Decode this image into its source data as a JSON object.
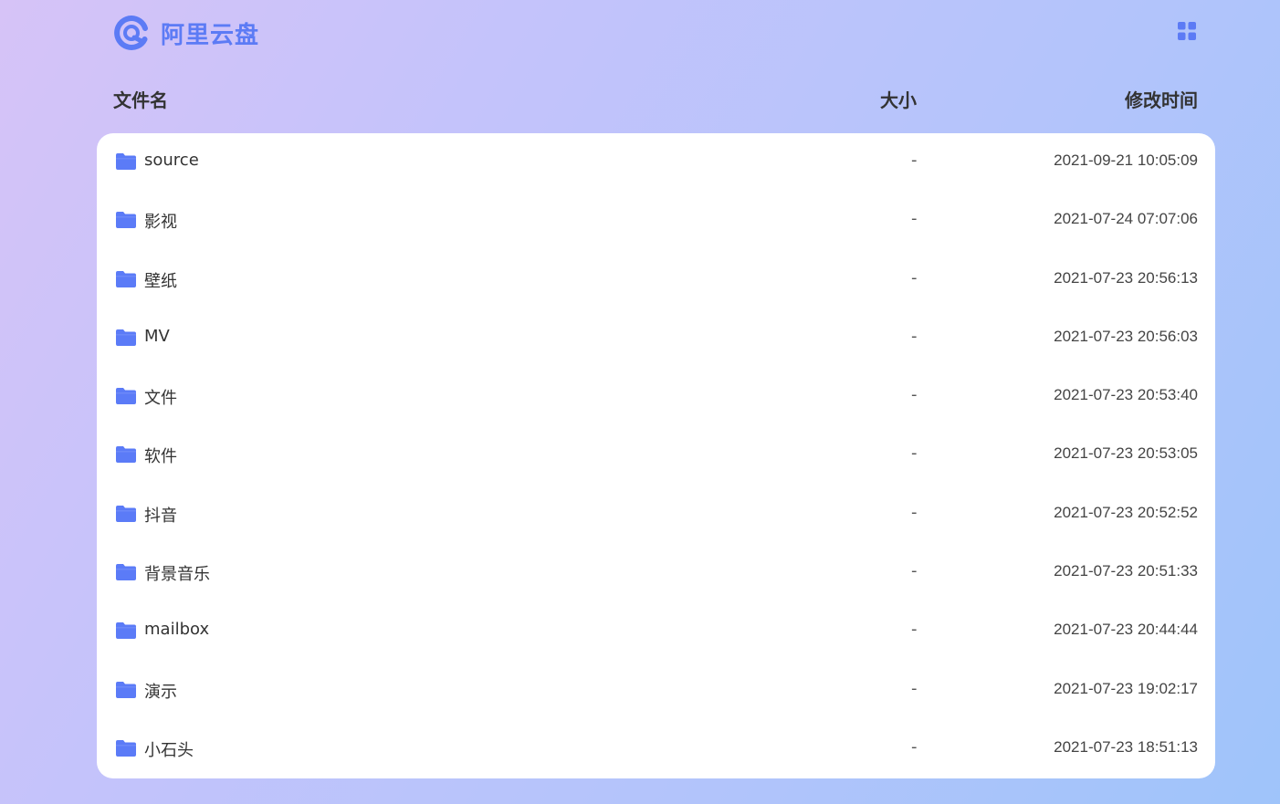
{
  "brand": {
    "name": "阿里云盘",
    "accent_color": "#5c7bf5",
    "logo_icon": "aliyun-drive-logo-icon"
  },
  "header": {
    "view_toggle_icon": "grid-view-icon"
  },
  "columns": {
    "name": "文件名",
    "size": "大小",
    "modified": "修改时间"
  },
  "files": [
    {
      "icon": "folder-icon",
      "name": "source",
      "size": "-",
      "modified": "2021-09-21 10:05:09"
    },
    {
      "icon": "folder-icon",
      "name": "影视",
      "size": "-",
      "modified": "2021-07-24 07:07:06"
    },
    {
      "icon": "folder-icon",
      "name": "壁纸",
      "size": "-",
      "modified": "2021-07-23 20:56:13"
    },
    {
      "icon": "folder-icon",
      "name": "MV",
      "size": "-",
      "modified": "2021-07-23 20:56:03"
    },
    {
      "icon": "folder-icon",
      "name": "文件",
      "size": "-",
      "modified": "2021-07-23 20:53:40"
    },
    {
      "icon": "folder-icon",
      "name": "软件",
      "size": "-",
      "modified": "2021-07-23 20:53:05"
    },
    {
      "icon": "folder-icon",
      "name": "抖音",
      "size": "-",
      "modified": "2021-07-23 20:52:52"
    },
    {
      "icon": "folder-icon",
      "name": "背景音乐",
      "size": "-",
      "modified": "2021-07-23 20:51:33"
    },
    {
      "icon": "folder-icon",
      "name": "mailbox",
      "size": "-",
      "modified": "2021-07-23 20:44:44"
    },
    {
      "icon": "folder-icon",
      "name": "演示",
      "size": "-",
      "modified": "2021-07-23 19:02:17"
    },
    {
      "icon": "folder-icon",
      "name": "小石头",
      "size": "-",
      "modified": "2021-07-23 18:51:13"
    }
  ]
}
